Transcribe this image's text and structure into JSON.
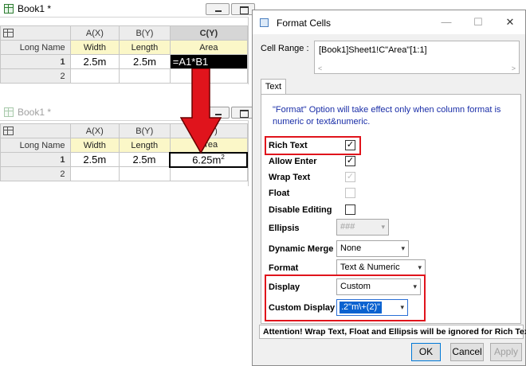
{
  "book_top": {
    "title": "Book1 *",
    "columns": [
      "A(X)",
      "B(Y)",
      "C(Y)"
    ],
    "long_name_label": "Long Name",
    "long_names": [
      "Width",
      "Length",
      "Area"
    ],
    "rows": [
      {
        "num": "1",
        "a": "2.5m",
        "b": "2.5m",
        "c": "=A1*B1"
      },
      {
        "num": "2",
        "a": "",
        "b": "",
        "c": ""
      }
    ]
  },
  "book_bottom": {
    "title": "Book1 *",
    "columns": [
      "A(X)",
      "B(Y)",
      "C(Y)"
    ],
    "long_name_label": "Long Name",
    "long_names": [
      "Width",
      "Length",
      "Area"
    ],
    "rows": [
      {
        "num": "1",
        "a": "2.5m",
        "b": "2.5m",
        "c_base": "6.25m",
        "c_sup": "2"
      },
      {
        "num": "2",
        "a": "",
        "b": "",
        "c": ""
      }
    ]
  },
  "dialog": {
    "title": "Format Cells",
    "cell_range_label": "Cell Range :",
    "cell_range_value": "[Book1]Sheet1!C\"Area\"[1:1]",
    "tab_label": "Text",
    "note": "\"Format\" Option will take effect only when column format is numeric or text&numeric.",
    "rich_text_label": "Rich Text",
    "rich_text_checked": true,
    "allow_enter_label": "Allow Enter",
    "allow_enter_checked": true,
    "wrap_text_label": "Wrap Text",
    "wrap_text_checked": true,
    "float_label": "Float",
    "disable_editing_label": "Disable Editing",
    "ellipsis_label": "Ellipsis",
    "ellipsis_value": "###",
    "dynamic_merge_label": "Dynamic Merge",
    "dynamic_merge_value": "None",
    "format_label": "Format",
    "format_value": "Text & Numeric",
    "display_label": "Display",
    "display_value": "Custom",
    "custom_display_label": "Custom Display",
    "custom_display_value": ".2\"m\\+(2)\"",
    "attention": "Attention! Wrap Text, Float and Ellipsis will be ignored for Rich Text.",
    "ok_label": "OK",
    "cancel_label": "Cancel",
    "apply_label": "Apply"
  },
  "colors": {
    "highlight": "#e0141c",
    "long_name_bg": "#fbf7c8",
    "note_text": "#1a2ea8"
  },
  "icons": {
    "check": "✓",
    "caret": "▾",
    "close": "✕",
    "minimize": "—",
    "maximize": "☐"
  }
}
